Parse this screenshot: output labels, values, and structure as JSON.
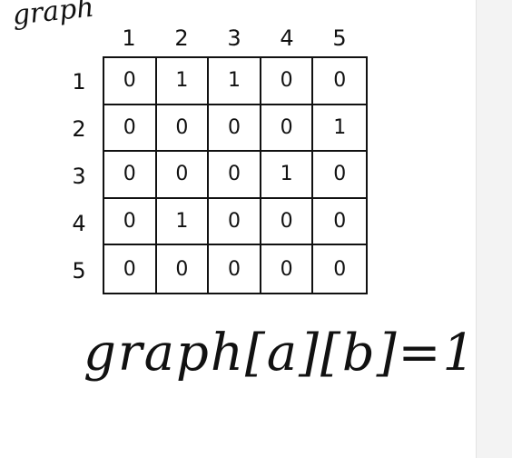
{
  "title": "graph",
  "column_labels": [
    "1",
    "2",
    "3",
    "4",
    "5"
  ],
  "row_labels": [
    "1",
    "2",
    "3",
    "4",
    "5"
  ],
  "matrix": [
    [
      "0",
      "1",
      "1",
      "0",
      "0"
    ],
    [
      "0",
      "0",
      "0",
      "0",
      "1"
    ],
    [
      "0",
      "0",
      "0",
      "1",
      "0"
    ],
    [
      "0",
      "1",
      "0",
      "0",
      "0"
    ],
    [
      "0",
      "0",
      "0",
      "0",
      "0"
    ]
  ],
  "formula": "graph[a][b]=1"
}
